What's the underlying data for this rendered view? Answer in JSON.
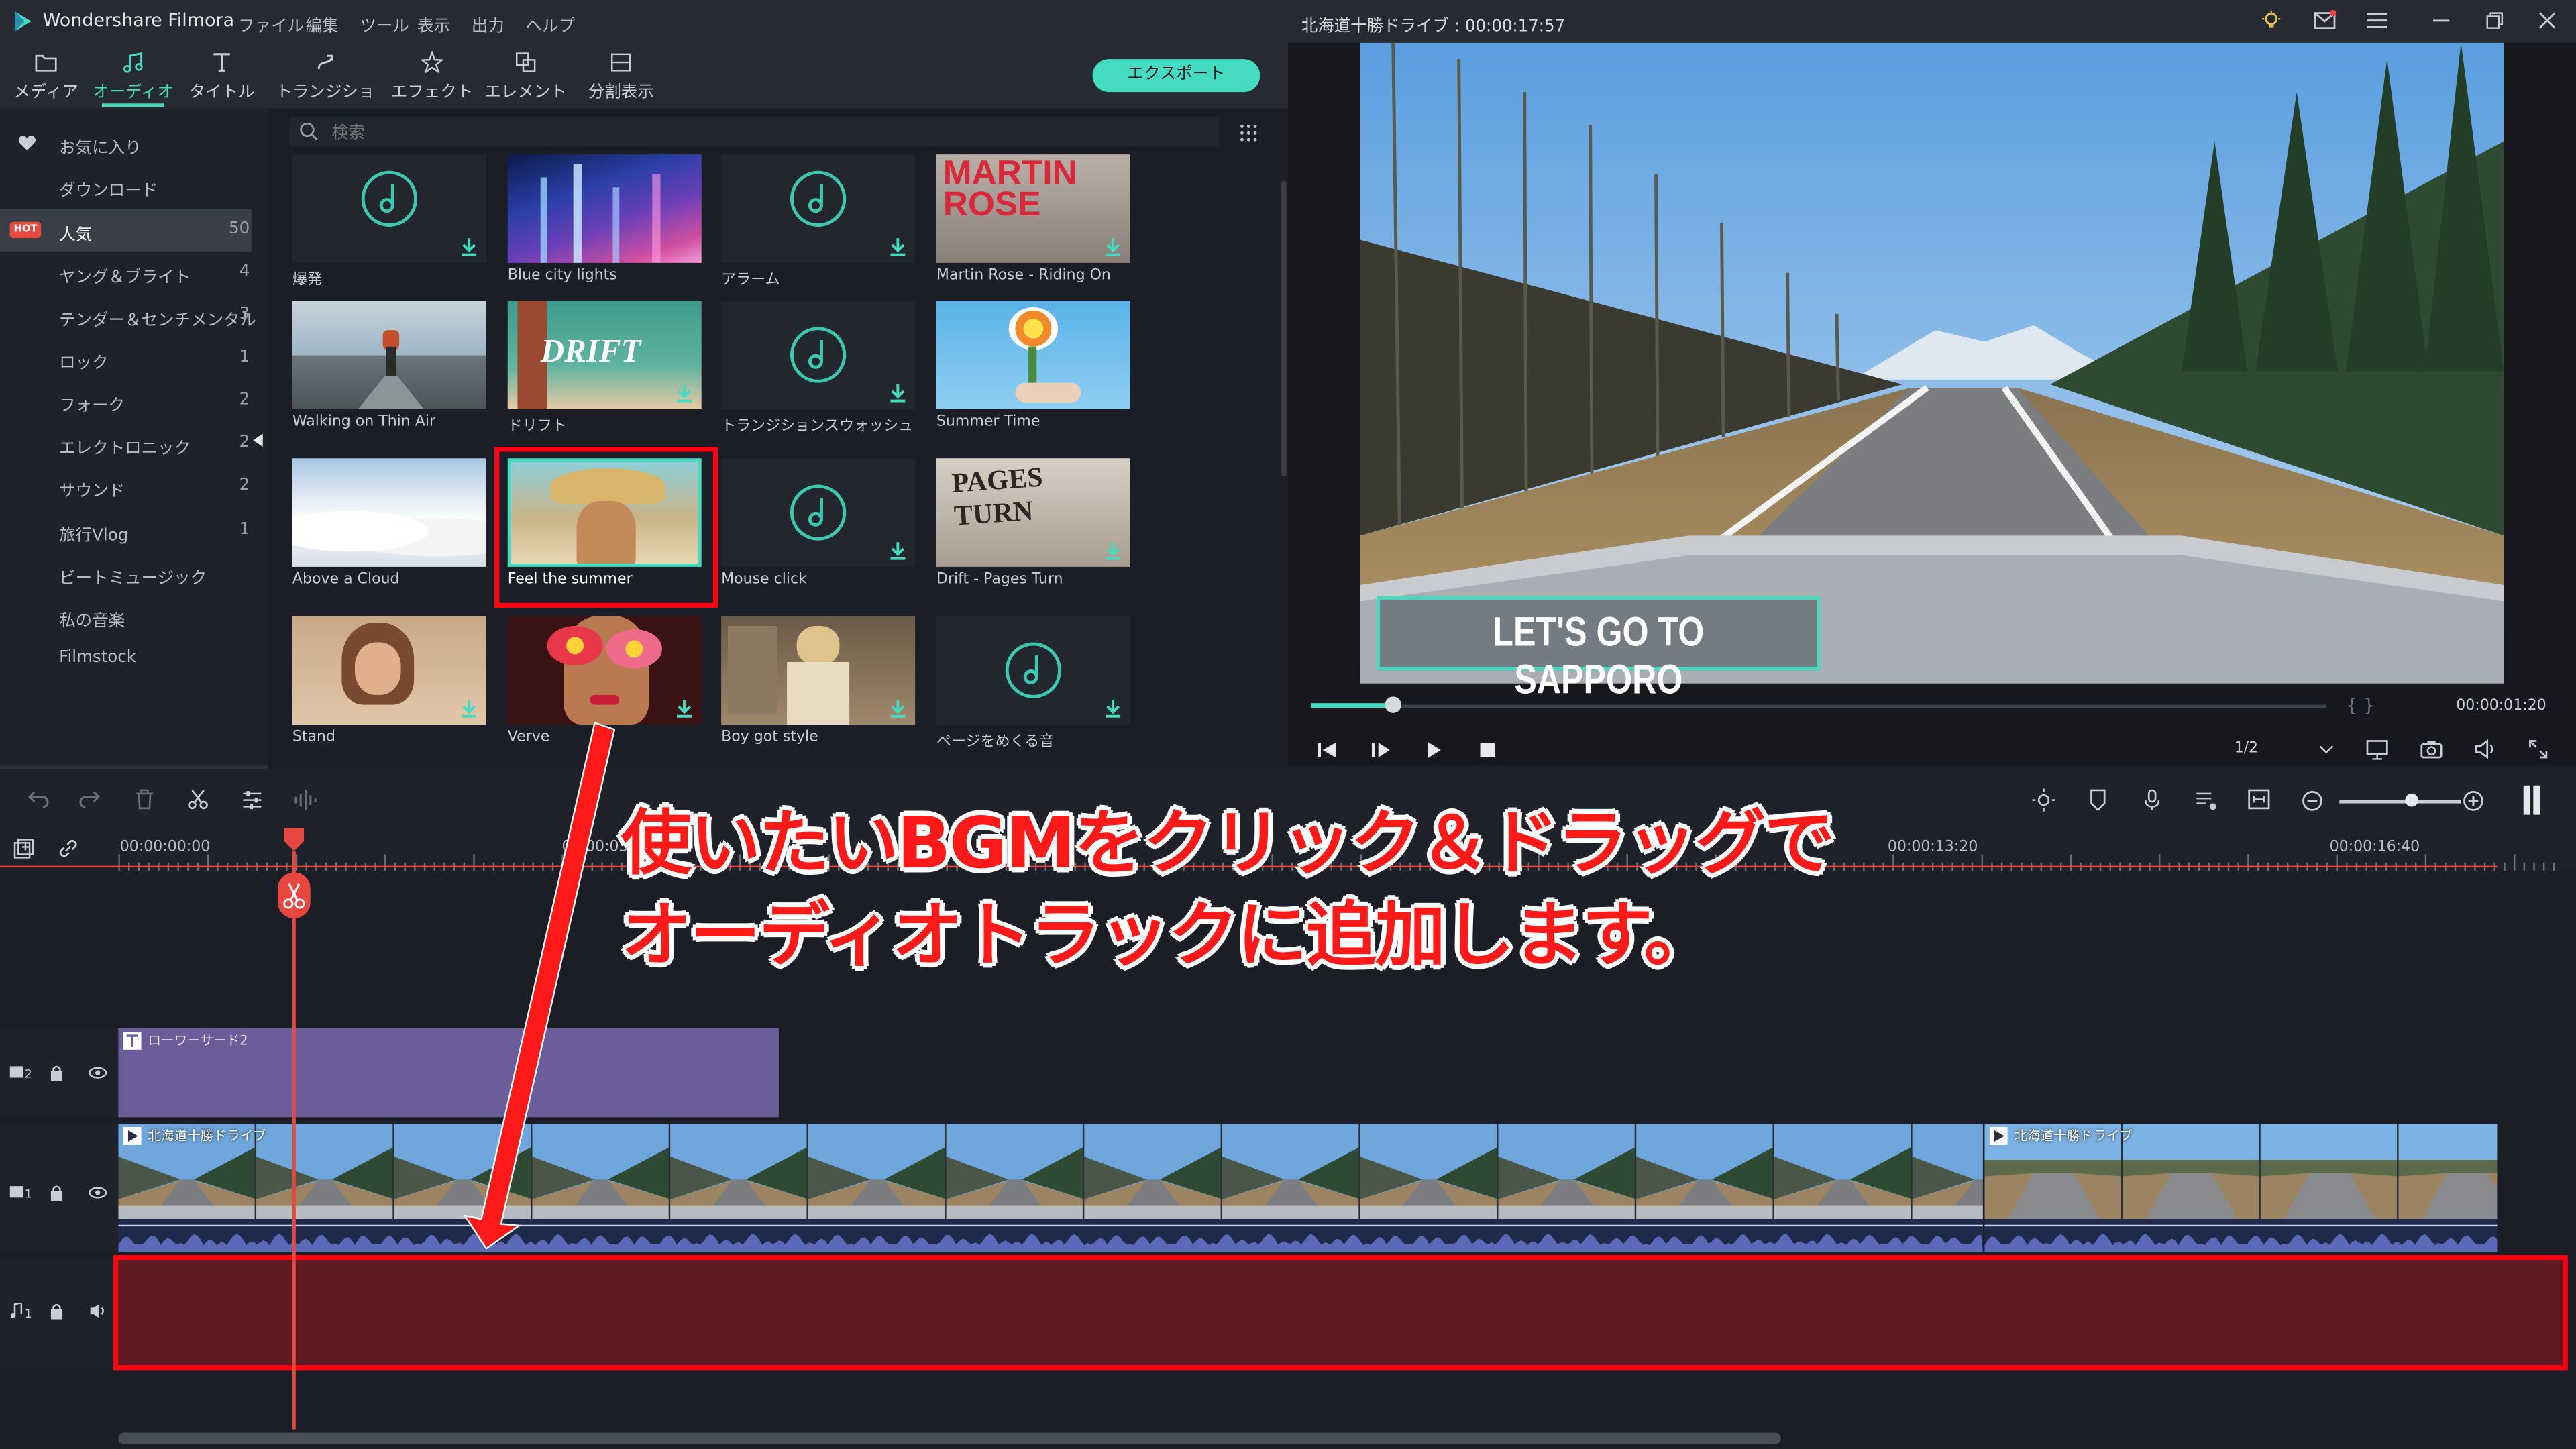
{
  "app": {
    "name": "Wondershare Filmora",
    "project_title": "北海道十勝ドライブ : 00:00:17:57",
    "menu": [
      "ファイル",
      "編集",
      "ツール",
      "表示",
      "出力",
      "ヘルプ"
    ]
  },
  "toolbar": {
    "tabs": [
      "メディア",
      "オーディオ",
      "タイトル",
      "トランジション",
      "エフェクト",
      "エレメント",
      "分割表示"
    ],
    "active_tab": "オーディオ",
    "export_label": "エクスポート"
  },
  "sidebar": {
    "hot_badge": "HOT",
    "items": [
      {
        "label": "お気に入り",
        "count": ""
      },
      {
        "label": "ダウンロード",
        "count": ""
      },
      {
        "label": "人気",
        "count": "50"
      },
      {
        "label": "ヤング＆ブライト",
        "count": "4"
      },
      {
        "label": "テンダー＆センチメンタル",
        "count": "3"
      },
      {
        "label": "ロック",
        "count": "1"
      },
      {
        "label": "フォーク",
        "count": "2"
      },
      {
        "label": "エレクトロニック",
        "count": "2"
      },
      {
        "label": "サウンド",
        "count": "2"
      },
      {
        "label": "旅行Vlog",
        "count": "1"
      },
      {
        "label": "ビートミュージック",
        "count": ""
      },
      {
        "label": "私の音楽",
        "count": ""
      },
      {
        "label": "Filmstock",
        "count": ""
      }
    ]
  },
  "search": {
    "placeholder": "検索"
  },
  "library": {
    "items": [
      {
        "title": "爆発",
        "thumb_text": ""
      },
      {
        "title": "Blue city lights",
        "thumb_text": ""
      },
      {
        "title": "アラーム",
        "thumb_text": ""
      },
      {
        "title": "Martin Rose - Riding On",
        "thumb_text": "MARTIN ROSE"
      },
      {
        "title": "Walking on Thin Air",
        "thumb_text": ""
      },
      {
        "title": "ドリフト",
        "thumb_text": "DRIFT"
      },
      {
        "title": "トランジションスウォッシュ",
        "thumb_text": ""
      },
      {
        "title": "Summer Time",
        "thumb_text": ""
      },
      {
        "title": "Above a Cloud",
        "thumb_text": ""
      },
      {
        "title": "Feel the summer",
        "thumb_text": ""
      },
      {
        "title": "Mouse click",
        "thumb_text": ""
      },
      {
        "title": "Drift - Pages Turn",
        "thumb_text": "PAGES TURN"
      },
      {
        "title": "Stand",
        "thumb_text": ""
      },
      {
        "title": "Verve",
        "thumb_text": ""
      },
      {
        "title": "Boy got style",
        "thumb_text": ""
      },
      {
        "title": "ページをめくる音",
        "thumb_text": ""
      }
    ]
  },
  "preview": {
    "overlay_text": "LET'S GO TO SAPPORO",
    "timecode": "00:00:01:20",
    "brackets": "{     }",
    "quality": "1/2",
    "progress": 0.08
  },
  "timeline": {
    "ruler": [
      "00:00:00:00",
      "00:00:03",
      "00:0",
      "00:00:13:20",
      "00:00:16:40"
    ],
    "text_clip": "ローワーサード2",
    "video_clip_1": "北海道十勝ドライブ",
    "video_clip_2": "北海道十勝ドライブ"
  },
  "annotation": {
    "line1": "使いたいBGMをクリック＆ドラッグで",
    "line2": "オーディオトラックに追加します。"
  },
  "colors": {
    "accent": "#44dbc0",
    "highlight": "#ff0010",
    "audio_track": "#5e1c22"
  }
}
